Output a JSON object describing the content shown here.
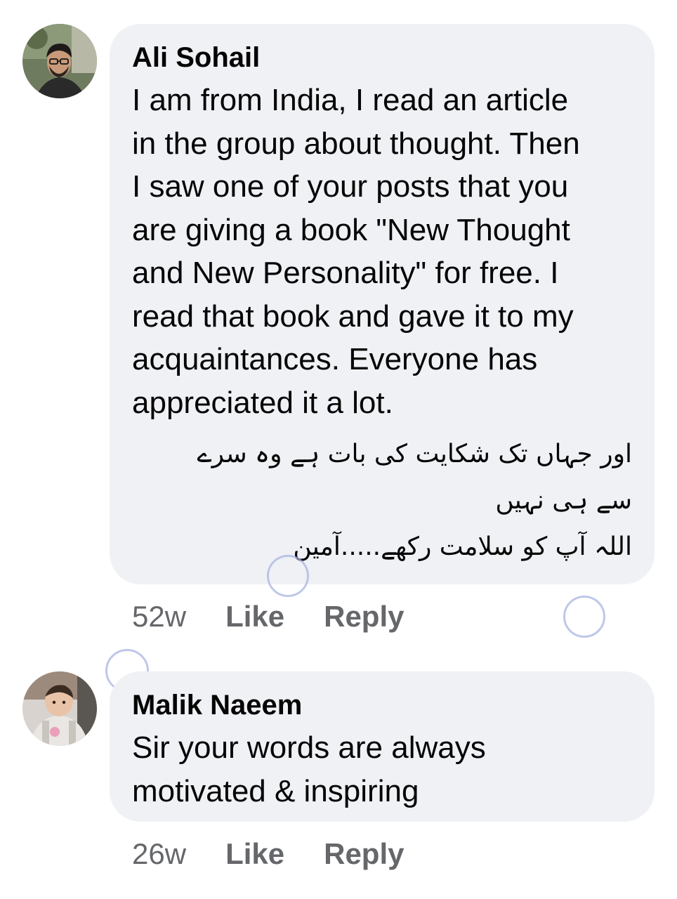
{
  "comments": [
    {
      "author": "Ali Sohail",
      "body_lines": [
        "I am from India, I read an article",
        "in the group about thought. Then",
        "I saw one of your posts that you",
        "are giving a book \"New Thought",
        "and New Personality\" for free. I",
        "read that book and gave it to my",
        "acquaintances. Everyone has",
        "appreciated it a lot."
      ],
      "urdu_lines": [
        "اور جہاں تک شکایت کی بات ہے وہ سرے",
        "سے ہی نہیں",
        "اللہ آپ کو سلامت رکھے.....آمین"
      ],
      "time": "52w",
      "like_label": "Like",
      "reply_label": "Reply"
    },
    {
      "author": "Malik Naeem",
      "body_lines": [
        "Sir your words are always",
        "motivated & inspiring"
      ],
      "time": "26w",
      "like_label": "Like",
      "reply_label": "Reply"
    }
  ],
  "colors": {
    "bubble": "#f0f1f5",
    "text": "#050505",
    "meta": "#65676b"
  },
  "icons": [
    "avatar-photo"
  ]
}
